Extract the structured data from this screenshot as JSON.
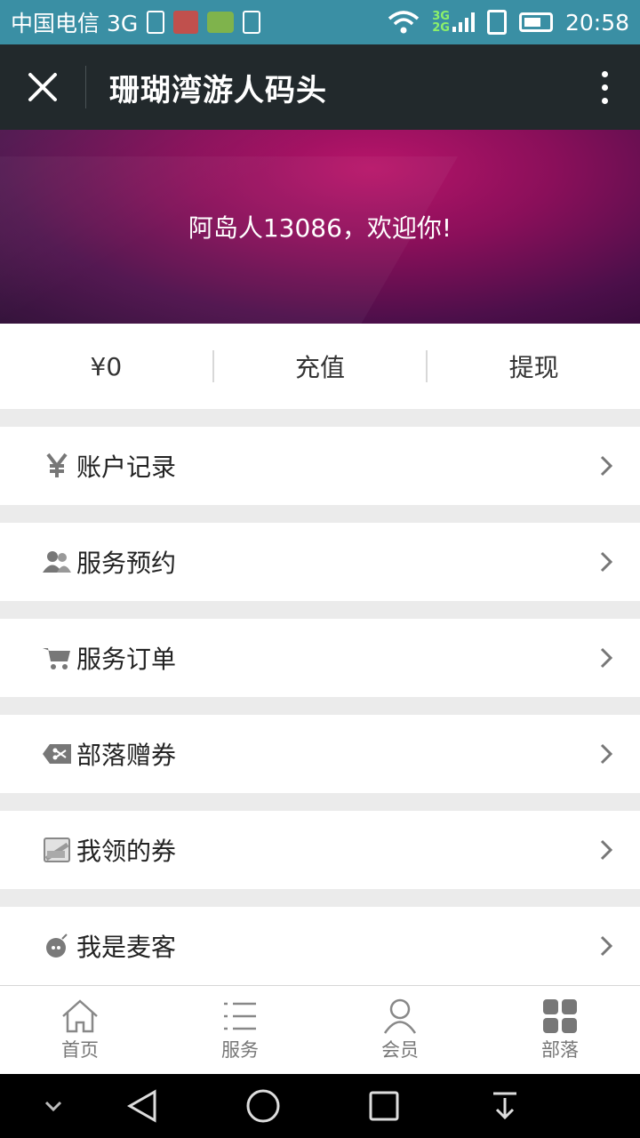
{
  "status_bar": {
    "carrier": "中国电信 3G",
    "network_top": "3G",
    "network_bottom": "2G",
    "time": "20:58"
  },
  "title_bar": {
    "title": "珊瑚湾游人码头",
    "close_icon": "close-icon",
    "more_icon": "more-vertical-icon"
  },
  "banner": {
    "welcome": "阿岛人13086，欢迎你!"
  },
  "balance": {
    "amount": "¥0",
    "recharge": "充值",
    "withdraw": "提现"
  },
  "menu": [
    {
      "label": "账户记录",
      "icon": "yen-icon"
    },
    {
      "label": "服务预约",
      "icon": "users-icon"
    },
    {
      "label": "服务订单",
      "icon": "cart-icon"
    },
    {
      "label": "部落赠券",
      "icon": "coupon-icon"
    },
    {
      "label": "我领的券",
      "icon": "ticket-icon"
    },
    {
      "label": "我是麦客",
      "icon": "bomb-icon"
    }
  ],
  "bottom_nav": [
    {
      "label": "首页",
      "icon": "home-icon"
    },
    {
      "label": "服务",
      "icon": "list-icon"
    },
    {
      "label": "会员",
      "icon": "user-icon"
    },
    {
      "label": "部落",
      "icon": "grid-icon"
    }
  ],
  "colors": {
    "status_bar": "#3a8fa4",
    "title_bar": "#22292c",
    "banner": "#8a0f5a",
    "page_bg": "#ebebeb"
  }
}
